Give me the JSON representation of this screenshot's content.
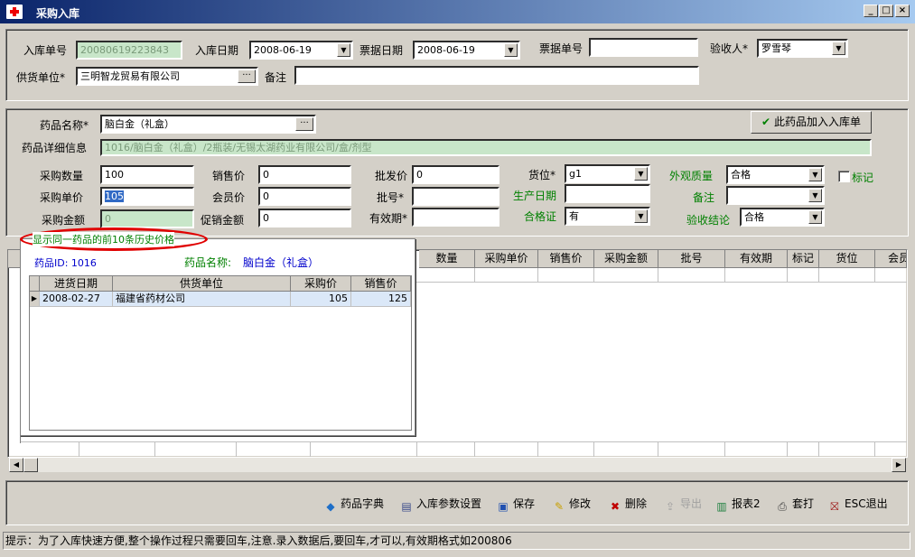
{
  "window": {
    "title": "采购入库",
    "min_label": "_",
    "max_label": "□",
    "close_label": "×"
  },
  "header": {
    "receipt_no_label": "入库单号",
    "receipt_no_value": "20080619223843",
    "date_label": "入库日期",
    "date_value": "2008-06-19",
    "bill_date_label": "票据日期",
    "bill_date_value": "2008-06-19",
    "bill_no_label": "票据单号",
    "bill_no_value": "",
    "inspector_label": "验收人*",
    "inspector_value": "罗雪琴",
    "supplier_label": "供货单位*",
    "supplier_value": "三明智龙贸易有限公司",
    "supplier_btn": "···",
    "remark_label": "备注",
    "remark_value": ""
  },
  "drug": {
    "name_label": "药品名称*",
    "name_value": "脑白金（礼盒）",
    "name_btn": "···",
    "add_button": "此药品加入入库单",
    "detail_label": "药品详细信息",
    "detail_value": "1016/脑白金（礼盒）/2瓶装/无锡太湖药业有限公司/盒/剂型",
    "qty_label": "采购数量",
    "qty_value": "100",
    "unit_price_label": "采购单价",
    "unit_price_value": "105",
    "amount_label": "采购金额",
    "amount_value": "0",
    "sale_price_label": "销售价",
    "sale_price_value": "0",
    "member_price_label": "会员价",
    "member_price_value": "0",
    "promo_amount_label": "促销金额",
    "promo_amount_value": "0",
    "wholesale_label": "批发价",
    "wholesale_value": "0",
    "batch_label": "批号*",
    "batch_value": "",
    "expiry_label": "有效期*",
    "expiry_value": "",
    "location_label": "货位*",
    "location_value": "g1",
    "prod_date_label": "生产日期",
    "prod_date_value": "",
    "cert_label": "合格证",
    "cert_value": "有",
    "appearance_label": "外观质量",
    "appearance_value": "合格",
    "remark_label": "备注",
    "remark_value": "",
    "conclusion_label": "验收结论",
    "conclusion_value": "合格",
    "mark_label": "标记"
  },
  "grid": {
    "columns": [
      "数量",
      "采购单价",
      "销售价",
      "采购金额",
      "批号",
      "有效期",
      "标记",
      "货位",
      "会员"
    ]
  },
  "history": {
    "caption": "显示同一药品的前10条历史价格",
    "drug_id_label": "药品ID:",
    "drug_id_value": "1016",
    "drug_name_label": "药品名称:",
    "drug_name_value": "脑白金（礼盒）",
    "columns": [
      "进货日期",
      "供货单位",
      "采购价",
      "销售价"
    ],
    "rows": [
      {
        "date": "2008-02-27",
        "supplier": "福建省药材公司",
        "purchase": "105",
        "sale": "125"
      }
    ]
  },
  "toolbar": {
    "dict": "药品字典",
    "settings": "入库参数设置",
    "save": "保存",
    "edit": "修改",
    "delete": "删除",
    "export": "导出",
    "report": "报表2",
    "print": "套打",
    "exit": "ESC退出"
  },
  "status": {
    "text": "提示：为了入库快速方便,整个操作过程只需要回车,注意.录入数据后,要回车,才可以,有效期格式如200806"
  },
  "colors": {
    "title_start": "#0a246a",
    "title_end": "#a6caf0",
    "disabled_field": "#c8e6c9",
    "annotation": "#e00000"
  }
}
